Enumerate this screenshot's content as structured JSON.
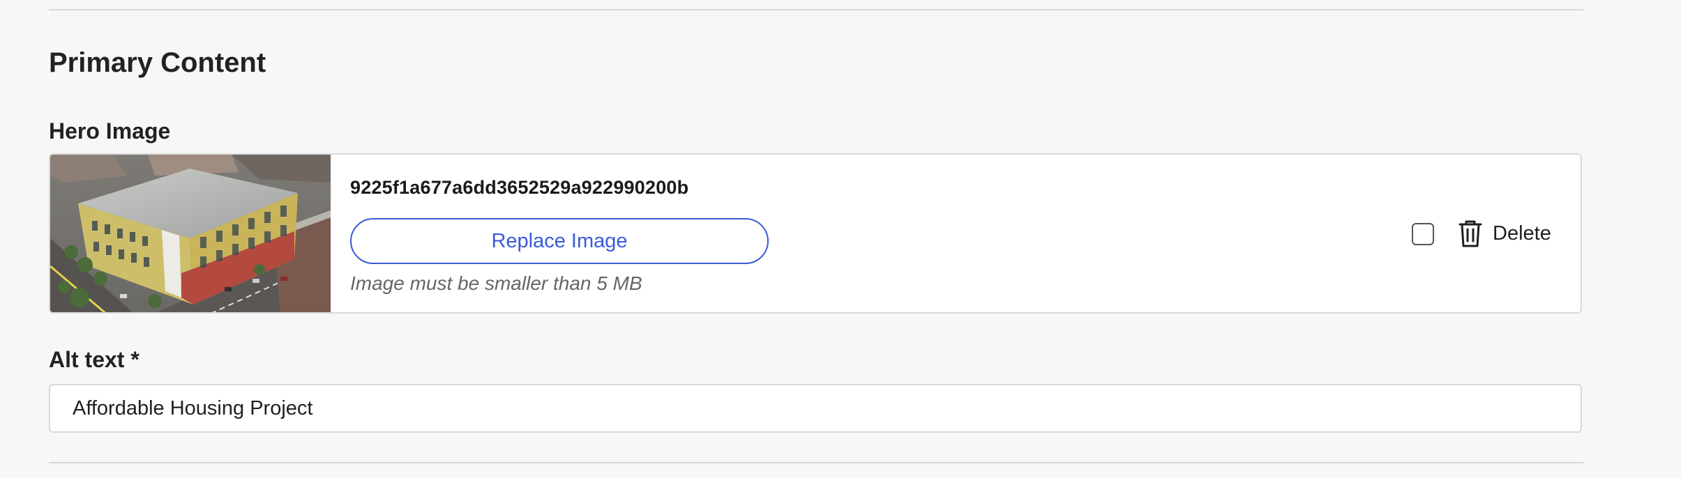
{
  "section": {
    "title": "Primary Content"
  },
  "hero_image": {
    "label": "Hero Image",
    "filename": "9225f1a677a6dd3652529a922990200b",
    "replace_label": "Replace Image",
    "hint": "Image must be smaller than 5 MB",
    "delete_label": "Delete",
    "selected": false,
    "thumbnail_icon": "building-photo"
  },
  "alt_text": {
    "label": "Alt text *",
    "value": "Affordable Housing Project"
  },
  "colors": {
    "accent": "#3a5bd9",
    "background": "#f7f7f7",
    "border": "#d9d9d9"
  }
}
